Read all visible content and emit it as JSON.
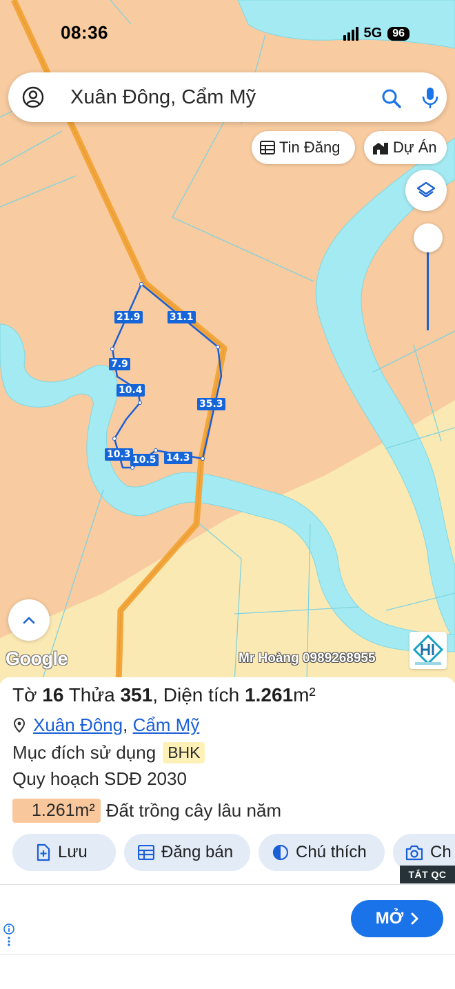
{
  "status": {
    "time": "08:36",
    "network": "5G",
    "battery": "96"
  },
  "search": {
    "query": "Xuân Đông, Cẩm Mỹ"
  },
  "chips": {
    "listing_label": "Tin Đăng",
    "project_label": "Dự Án"
  },
  "map": {
    "edge_labels": [
      "21.9",
      "31.1",
      "7.9",
      "10.4",
      "35.3",
      "10.3",
      "10.5",
      "14.3"
    ],
    "google_label": "Google",
    "watermark": "Mr Hoàng 0989268955"
  },
  "parcel": {
    "sheet_label": "Tờ",
    "sheet_no": "16",
    "lot_label": "Thửa",
    "lot_no": "351",
    "area_label": ", Diện tích",
    "area_value": "1.261",
    "area_unit": "m²",
    "commune": "Xuân Đông",
    "district": "Cẩm Mỹ",
    "usage_label": "Mục đích sử dụng",
    "usage_code": "BHK",
    "planning_label": "Quy hoạch SDĐ 2030",
    "plan_area": "1.261m²",
    "plan_type": "Đất trồng cây lâu năm",
    "plan_color": "#f8c79c"
  },
  "actions": {
    "save": "Lưu",
    "sell": "Đăng bán",
    "legend": "Chú thích",
    "capture": "Ch"
  },
  "ad": {
    "hide_label": "TẮT QC",
    "open_label": "MỞ"
  },
  "colors": {
    "accent": "#1a73e8",
    "land_orange": "#f8cba0",
    "land_yellow": "#fbe9b3",
    "water": "#a4eaf2",
    "road": "#f3a63a"
  }
}
